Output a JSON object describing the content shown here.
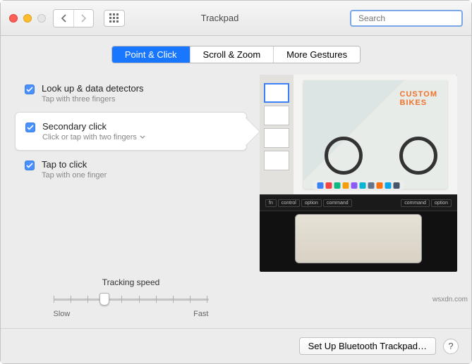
{
  "window": {
    "title": "Trackpad"
  },
  "search": {
    "placeholder": "Search"
  },
  "tabs": [
    {
      "label": "Point & Click",
      "active": true
    },
    {
      "label": "Scroll & Zoom",
      "active": false
    },
    {
      "label": "More Gestures",
      "active": false
    }
  ],
  "options": [
    {
      "title": "Look up & data detectors",
      "sub": "Tap with three fingers",
      "checked": true,
      "selected": false
    },
    {
      "title": "Secondary click",
      "sub": "Click or tap with two fingers",
      "checked": true,
      "selected": true,
      "has_dropdown": true
    },
    {
      "title": "Tap to click",
      "sub": "Tap with one finger",
      "checked": true,
      "selected": false
    }
  ],
  "slider": {
    "label": "Tracking speed",
    "min_label": "Slow",
    "max_label": "Fast",
    "ticks": 10,
    "value_index": 3
  },
  "preview": {
    "headline1": "CUSTOM",
    "headline2": "BIKES",
    "touchbar_keys": [
      "fn",
      "control",
      "option",
      "command",
      "command",
      "option"
    ]
  },
  "footer": {
    "bluetooth_label": "Set Up Bluetooth Trackpad…",
    "help_label": "?"
  },
  "watermark": "wsxdn.com"
}
